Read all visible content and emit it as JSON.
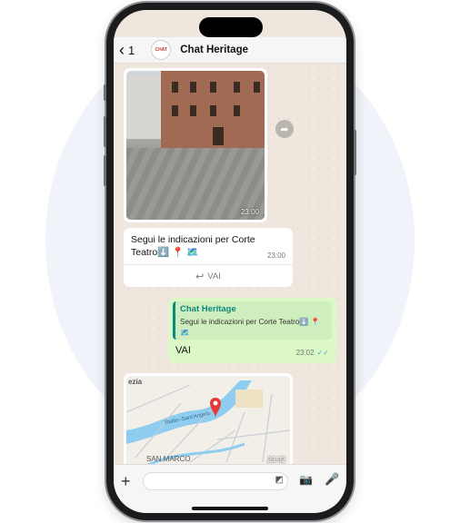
{
  "header": {
    "back_count": "1",
    "avatar_text": "CHAT",
    "title": "Chat Heritage"
  },
  "messages": {
    "image_time": "23:00",
    "text": "Segui le indicazioni per Corte Teatro⬇️ 📍 🗺️",
    "text_time": "23:00",
    "reply_button": "VAI",
    "quoted_title": "Chat Heritage",
    "quoted_text": "Segui le indicazioni per Corte Teatro⬇️ 📍 🗺️",
    "out_text": "VAI",
    "out_time": "23:02",
    "map_labels": {
      "top_left": "ezia",
      "bottom_left": "SAN MARCO",
      "canal": "Rialto–Sant'Angelo"
    },
    "map_time": "23:02"
  },
  "icons": {
    "back": "chevron-left-icon",
    "forward": "share-icon",
    "reply": "reply-icon",
    "plus": "plus-icon",
    "sticker": "sticker-icon",
    "camera": "camera-icon",
    "mic": "mic-icon",
    "pin": "location-pin-icon"
  },
  "colors": {
    "outgoing_bubble": "#dcf8c6",
    "accent": "#0a8a7e",
    "read_ticks": "#4fa3e0"
  }
}
